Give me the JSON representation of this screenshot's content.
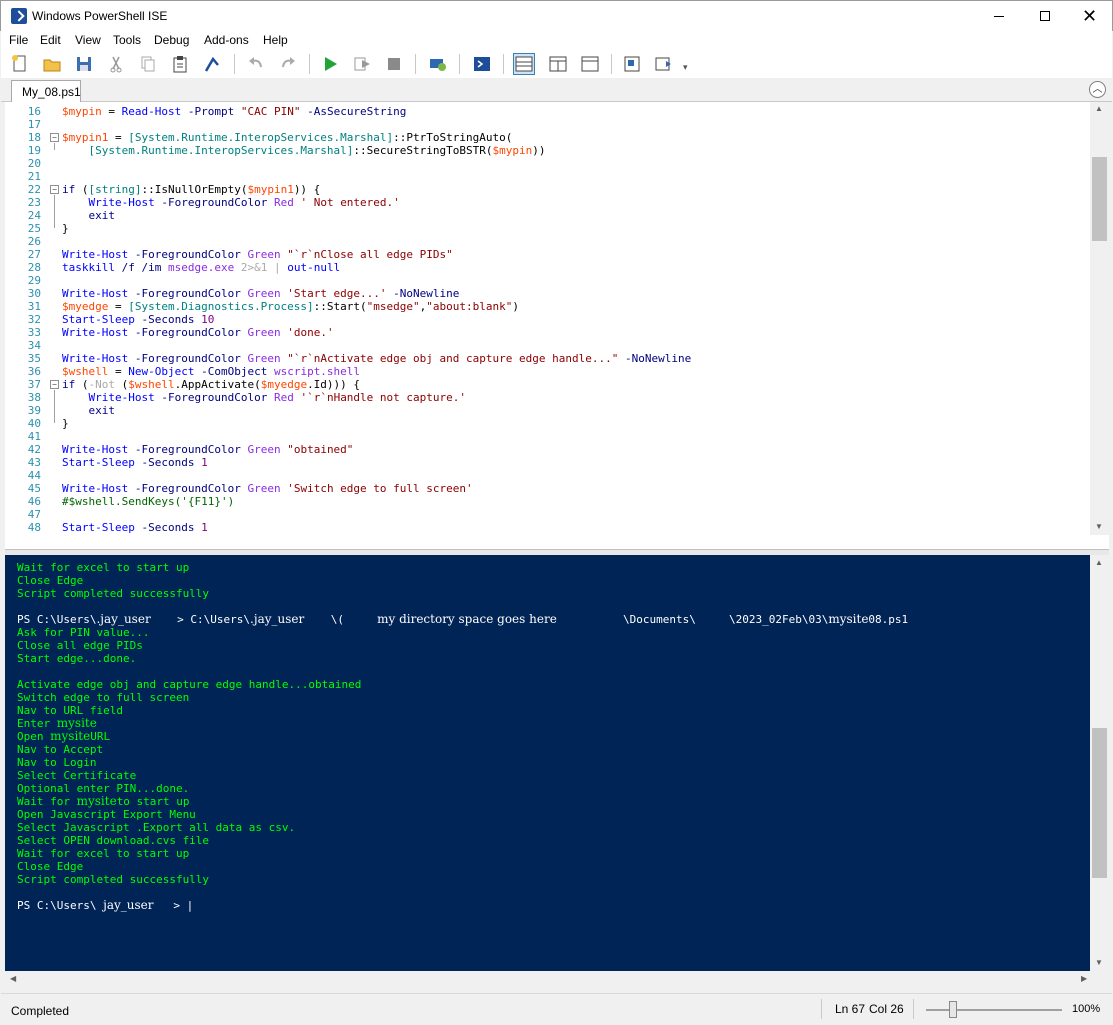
{
  "window": {
    "title": "Windows PowerShell ISE",
    "minimize_icon": "minimize-icon",
    "maximize_icon": "maximize-icon",
    "close_label": "✕"
  },
  "menu": [
    "File",
    "Edit",
    "View",
    "Tools",
    "Debug",
    "Add-ons",
    "Help"
  ],
  "toolbar": {
    "icons": [
      "new-file-icon",
      "open-folder-icon",
      "save-icon",
      "cut-icon",
      "copy-icon",
      "paste-icon",
      "clear-console-icon",
      "undo-icon",
      "redo-icon",
      "run-script-icon",
      "run-selection-icon",
      "stop-icon",
      "new-remote-tab-icon",
      "start-powershell-icon",
      "script-pane-top-icon",
      "script-pane-right-icon",
      "script-pane-maximized-icon",
      "show-command-window-icon",
      "show-command-addon-icon"
    ]
  },
  "tab": {
    "label": "My_08.ps1"
  },
  "editor": {
    "lines": [
      {
        "n": "16",
        "fold": "",
        "html": "<span class='k-var'>$mypin</span> = <span class='k-cmd'>Read-Host</span> <span class='k-par'>-Prompt</span> <span class='k-str'>\"CAC PIN\"</span> <span class='k-par'>-AsSecureString</span>"
      },
      {
        "n": "17",
        "fold": "",
        "html": ""
      },
      {
        "n": "18",
        "fold": "−",
        "html": "<span class='k-var'>$mypin1</span> = <span class='k-type'>[System.Runtime.InteropServices.Marshal]</span>::PtrToStringAuto("
      },
      {
        "n": "19",
        "fold": "",
        "html": "    <span class='k-type'>[System.Runtime.InteropServices.Marshal]</span>::SecureStringToBSTR(<span class='k-var'>$mypin</span>))"
      },
      {
        "n": "20",
        "fold": "",
        "html": ""
      },
      {
        "n": "21",
        "fold": "",
        "html": ""
      },
      {
        "n": "22",
        "fold": "−",
        "html": "<span class='k-kw'>if</span> (<span class='k-type'>[string]</span>::IsNullOrEmpty(<span class='k-var'>$mypin1</span>)) {"
      },
      {
        "n": "23",
        "fold": "",
        "html": "    <span class='k-cmd'>Write-Host</span> <span class='k-par'>-ForegroundColor</span> <span class='k-arg'>Red</span> <span class='k-str'>' Not entered.'</span>"
      },
      {
        "n": "24",
        "fold": "",
        "html": "    <span class='k-kw'>exit</span>"
      },
      {
        "n": "25",
        "fold": "",
        "html": "}"
      },
      {
        "n": "26",
        "fold": "",
        "html": ""
      },
      {
        "n": "27",
        "fold": "",
        "html": "<span class='k-cmd'>Write-Host</span> <span class='k-par'>-ForegroundColor</span> <span class='k-arg'>Green</span> <span class='k-str'>\"`r`nClose all edge PIDs\"</span>"
      },
      {
        "n": "28",
        "fold": "",
        "html": "<span class='k-cmd'>taskkill</span> <span class='k-par'>/f /im</span> <span class='k-arg'>msedge.exe</span> <span class='k-op'>2>&amp;1</span> <span class='k-op'>|</span> <span class='k-cmd'>out-null</span>"
      },
      {
        "n": "29",
        "fold": "",
        "html": ""
      },
      {
        "n": "30",
        "fold": "",
        "html": "<span class='k-cmd'>Write-Host</span> <span class='k-par'>-ForegroundColor</span> <span class='k-arg'>Green</span> <span class='k-str'>'Start edge...'</span> <span class='k-par'>-NoNewline</span>"
      },
      {
        "n": "31",
        "fold": "",
        "html": "<span class='k-var'>$myedge</span> = <span class='k-type'>[System.Diagnostics.Process]</span>::Start(<span class='k-str'>\"msedge\"</span>,<span class='k-str'>\"about:blank\"</span>)"
      },
      {
        "n": "32",
        "fold": "",
        "html": "<span class='k-cmd'>Start-Sleep</span> <span class='k-par'>-Seconds</span> <span class='k-num'>10</span>"
      },
      {
        "n": "33",
        "fold": "",
        "html": "<span class='k-cmd'>Write-Host</span> <span class='k-par'>-ForegroundColor</span> <span class='k-arg'>Green</span> <span class='k-str'>'done.'</span>"
      },
      {
        "n": "34",
        "fold": "",
        "html": ""
      },
      {
        "n": "35",
        "fold": "",
        "html": "<span class='k-cmd'>Write-Host</span> <span class='k-par'>-ForegroundColor</span> <span class='k-arg'>Green</span> <span class='k-str'>\"`r`nActivate edge obj and capture edge handle...\"</span> <span class='k-par'>-NoNewline</span>"
      },
      {
        "n": "36",
        "fold": "",
        "html": "<span class='k-var'>$wshell</span> = <span class='k-cmd'>New-Object</span> <span class='k-par'>-ComObject</span> <span class='k-arg'>wscript.shell</span>"
      },
      {
        "n": "37",
        "fold": "−",
        "html": "<span class='k-kw'>if</span> (<span class='k-op'>-Not</span> (<span class='k-var'>$wshell</span>.AppActivate(<span class='k-var'>$myedge</span>.Id))) {"
      },
      {
        "n": "38",
        "fold": "",
        "html": "    <span class='k-cmd'>Write-Host</span> <span class='k-par'>-ForegroundColor</span> <span class='k-arg'>Red</span> <span class='k-str'>'`r`nHandle not capture.'</span>"
      },
      {
        "n": "39",
        "fold": "",
        "html": "    <span class='k-kw'>exit</span>"
      },
      {
        "n": "40",
        "fold": "",
        "html": "}"
      },
      {
        "n": "41",
        "fold": "",
        "html": ""
      },
      {
        "n": "42",
        "fold": "",
        "html": "<span class='k-cmd'>Write-Host</span> <span class='k-par'>-ForegroundColor</span> <span class='k-arg'>Green</span> <span class='k-str'>\"obtained\"</span>"
      },
      {
        "n": "43",
        "fold": "",
        "html": "<span class='k-cmd'>Start-Sleep</span> <span class='k-par'>-Seconds</span> <span class='k-num'>1</span>"
      },
      {
        "n": "44",
        "fold": "",
        "html": ""
      },
      {
        "n": "45",
        "fold": "",
        "html": "<span class='k-cmd'>Write-Host</span> <span class='k-par'>-ForegroundColor</span> <span class='k-arg'>Green</span> <span class='k-str'>'Switch edge to full screen'</span>"
      },
      {
        "n": "46",
        "fold": "",
        "html": "<span class='k-cmt'>#$wshell.SendKeys('{F11}')</span>"
      },
      {
        "n": "47",
        "fold": "",
        "html": ""
      },
      {
        "n": "48",
        "fold": "",
        "html": "<span class='k-cmd'>Start-Sleep</span> <span class='k-par'>-Seconds</span> <span class='k-num'>1</span>"
      }
    ]
  },
  "console": {
    "lines": [
      {
        "text": "Wait for excel to start up",
        "white": false
      },
      {
        "text": "Close Edge",
        "white": false
      },
      {
        "text": "Script completed successfully",
        "white": false
      },
      {
        "text": "",
        "white": false
      },
      {
        "html": "PS C:\\Users\\<span class='hand'>.jay_user</span>    > C:\\Users\\<span class='hand'>.jay_user</span>    \\(     <span class='hand'>my directory space goes here</span>          \\Documents\\     \\2023_02Feb\\03\\<span class='hand'>mysite</span>08.ps1",
        "white": true
      },
      {
        "text": "Ask for PIN value...",
        "white": false
      },
      {
        "text": "Close all edge PIDs",
        "white": false
      },
      {
        "text": "Start edge...done.",
        "white": false
      },
      {
        "text": "",
        "white": false
      },
      {
        "text": "Activate edge obj and capture edge handle...obtained",
        "white": false
      },
      {
        "text": "Switch edge to full screen",
        "white": false
      },
      {
        "text": "Nav to URL field",
        "white": false
      },
      {
        "html": "Enter <span class='hand'>mysite</span>",
        "white": false
      },
      {
        "html": "Open <span class='hand'>mysite</span>URL",
        "white": false
      },
      {
        "text": "Nav to Accept",
        "white": false
      },
      {
        "text": "Nav to Login",
        "white": false
      },
      {
        "text": "Select Certificate",
        "white": false
      },
      {
        "text": "Optional enter PIN...done.",
        "white": false
      },
      {
        "html": "Wait for <span class='hand'>mysite</span>to start up",
        "white": false
      },
      {
        "text": "Open Javascript Export Menu",
        "white": false
      },
      {
        "text": "Select Javascript .Export all data as csv.",
        "white": false
      },
      {
        "text": "Select OPEN download.cvs file",
        "white": false
      },
      {
        "text": "Wait for excel to start up",
        "white": false
      },
      {
        "text": "Close Edge",
        "white": false
      },
      {
        "text": "Script completed successfully",
        "white": false
      },
      {
        "text": "",
        "white": false
      },
      {
        "html": "PS C:\\Users\\ <span class='hand'>jay_user</span>   > |",
        "white": true
      }
    ]
  },
  "status": {
    "text": "Completed",
    "line": "Ln 67",
    "col": "Col 26",
    "zoom": "100%",
    "zoom_level": 0.2
  },
  "colors": {
    "console_bg": "#012456",
    "console_fg": "#00ff00",
    "line_number": "#2b91af"
  }
}
